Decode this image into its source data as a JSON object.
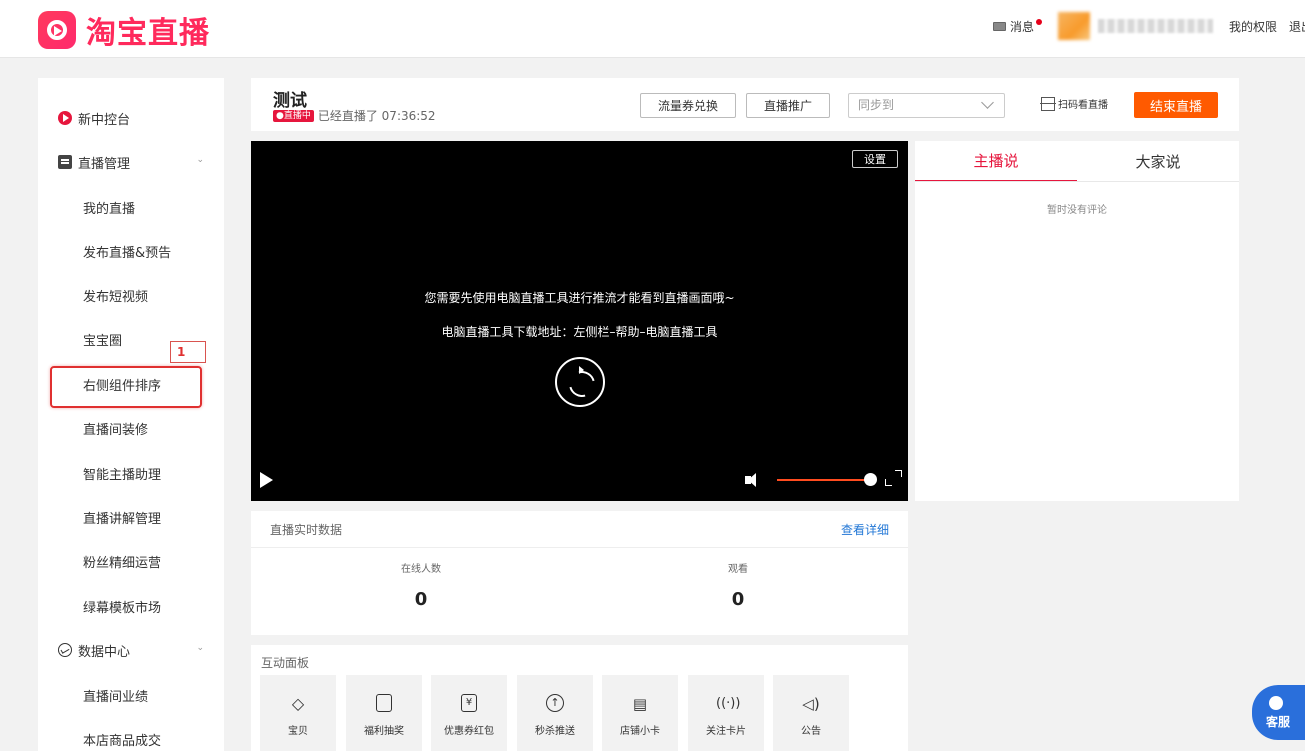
{
  "brand": {
    "logo_text": "淘宝直播"
  },
  "header": {
    "messages_label": "消息",
    "permissions_label": "我的权限",
    "logout_label": "退出"
  },
  "sidebar": {
    "console_label": "新中控台",
    "live_mgmt_label": "直播管理",
    "live_items": [
      "我的直播",
      "发布直播&预告",
      "发布短视频",
      "宝宝圈",
      "右侧组件排序",
      "直播间装修",
      "智能主播助理",
      "直播讲解管理",
      "粉丝精细运营",
      "绿幕模板市场"
    ],
    "data_center_label": "数据中心",
    "data_items": [
      "直播间业绩",
      "本店商品成交"
    ]
  },
  "annotation": {
    "number": "1"
  },
  "live": {
    "title": "测试",
    "badge": "●直播中",
    "duration": "已经直播了 07:36:52",
    "traffic_coupon_btn": "流量券兑换",
    "promote_btn": "直播推广",
    "sync_placeholder": "同步到",
    "scan_label": "扫码看直播",
    "end_btn": "结束直播"
  },
  "video": {
    "settings_label": "设置",
    "message_1": "您需要先使用电脑直播工具进行推流才能看到直播画面哦~",
    "message_2": "电脑直播工具下载地址：左侧栏–帮助–电脑直播工具",
    "volume_level": 1.0
  },
  "comments": {
    "tab_host": "主播说",
    "tab_all": "大家说",
    "empty": "暂时没有评论"
  },
  "realtime": {
    "title": "直播实时数据",
    "detail_link": "查看详细",
    "online_label": "在线人数",
    "online_value": "0",
    "view_label": "观看",
    "view_value": "0"
  },
  "interaction": {
    "title": "互动面板",
    "tiles": [
      "宝贝",
      "福利抽奖",
      "优惠券红包",
      "秒杀推送",
      "店铺小卡",
      "关注卡片",
      "公告"
    ]
  },
  "service": {
    "label": "客服"
  },
  "colors": {
    "brand": "#ff2a5c",
    "live_red": "#e6163d",
    "end_button": "#ff5a00",
    "link": "#2277d6",
    "annotation": "#e03030"
  }
}
